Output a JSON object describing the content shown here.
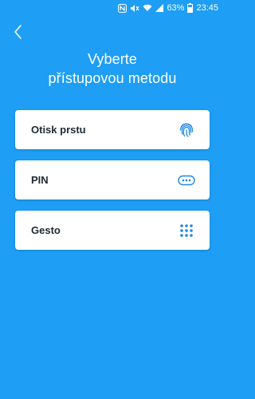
{
  "status_bar": {
    "battery": "63%",
    "time": "23:45"
  },
  "header": {
    "title_line1": "Vyberte",
    "title_line2": "přístupovou metodu"
  },
  "options": [
    {
      "label": "Otisk prstu",
      "icon": "fingerprint-icon"
    },
    {
      "label": "PIN",
      "icon": "pin-dots-icon"
    },
    {
      "label": "Gesto",
      "icon": "gesture-grid-icon"
    }
  ],
  "colors": {
    "background": "#1E9EF5",
    "icon": "#1E88E5"
  }
}
